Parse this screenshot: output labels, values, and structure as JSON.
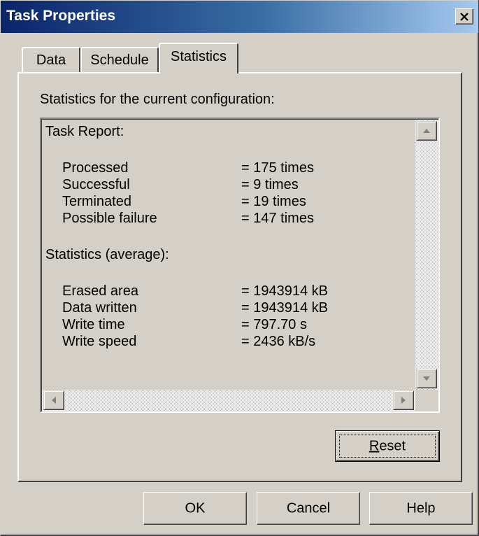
{
  "window": {
    "title": "Task Properties",
    "close_icon": "close-x-icon"
  },
  "tabs": [
    {
      "label": "Data",
      "active": false
    },
    {
      "label": "Schedule",
      "active": false
    },
    {
      "label": "Statistics",
      "active": true
    }
  ],
  "statistics": {
    "caption": "Statistics for the current configuration:",
    "task_report": {
      "heading": "Task Report:",
      "rows": [
        {
          "label": "Processed",
          "value": "= 175 times"
        },
        {
          "label": "Successful",
          "value": "= 9 times"
        },
        {
          "label": "Terminated",
          "value": "= 19 times"
        },
        {
          "label": "Possible failure",
          "value": "= 147 times"
        }
      ]
    },
    "average": {
      "heading": "Statistics (average):",
      "rows": [
        {
          "label": "Erased area",
          "value": "= 1943914 kB"
        },
        {
          "label": "Data written",
          "value": "= 1943914 kB"
        },
        {
          "label": "Write time",
          "value": "= 797.70 s"
        },
        {
          "label": "Write speed",
          "value": "= 2436 kB/s"
        }
      ]
    },
    "reset_label_accel": "R",
    "reset_label_rest": "eset"
  },
  "footer": {
    "ok_label": "OK",
    "cancel_label": "Cancel",
    "help_label": "Help"
  },
  "colors": {
    "title_gradient_start": "#0a246a",
    "title_gradient_end": "#a6caf0",
    "face": "#d4d0c8"
  }
}
